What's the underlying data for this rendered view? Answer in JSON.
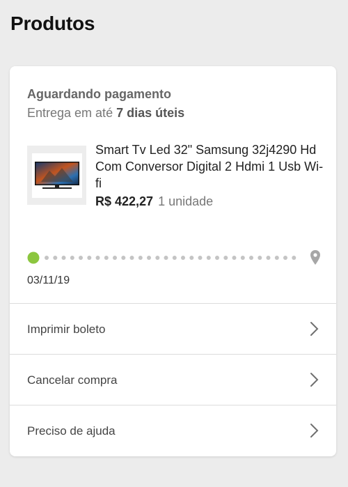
{
  "page": {
    "title": "Produtos"
  },
  "order": {
    "status": "Aguardando pagamento",
    "delivery_prefix": "Entrega em até",
    "delivery_days": "7 dias úteis",
    "product": {
      "name": "Smart Tv Led 32\" Samsung 32j4290 Hd Com Conversor Digital 2 Hdmi 1 Usb Wi-fi",
      "price": "R$ 422,27",
      "quantity": "1 unidade",
      "image_icon": "tv-thumbnail"
    },
    "tracking": {
      "date": "03/11/19",
      "progress_fraction": 0,
      "start_color": "#8cc63f",
      "end_icon": "location-pin-icon"
    }
  },
  "actions": [
    {
      "label": "Imprimir boleto",
      "icon": "chevron-right-icon"
    },
    {
      "label": "Cancelar compra",
      "icon": "chevron-right-icon"
    },
    {
      "label": "Preciso de ajuda",
      "icon": "chevron-right-icon"
    }
  ]
}
